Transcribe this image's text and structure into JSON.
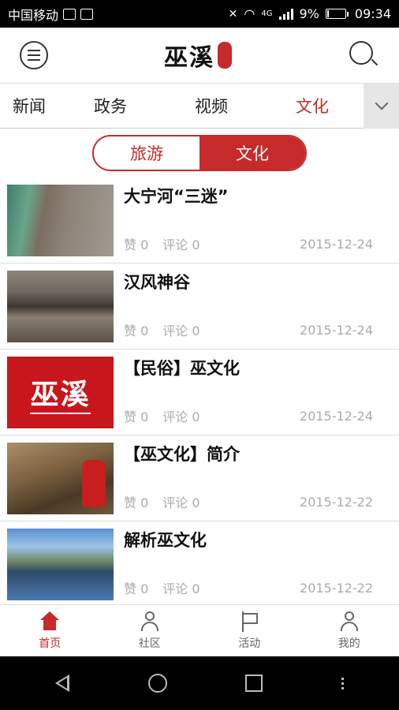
{
  "status_bar": {
    "carrier": "中国移动",
    "network": "4G",
    "battery": "9%",
    "battery_level": 0.09,
    "time": "09:34"
  },
  "header": {
    "logo_text": "巫溪",
    "menu_icon": "menu-icon",
    "search_icon": "search-icon"
  },
  "category_tabs": [
    {
      "label": "新闻",
      "active": false
    },
    {
      "label": "政务",
      "active": false
    },
    {
      "label": "视频",
      "active": false
    },
    {
      "label": "文化",
      "active": true
    }
  ],
  "sub_tabs": [
    {
      "label": "旅游",
      "active": false
    },
    {
      "label": "文化",
      "active": true
    }
  ],
  "articles": [
    {
      "title": "大宁河“三迷”",
      "likes": "赞 0",
      "comments": "评论 0",
      "date": "2015-12-24"
    },
    {
      "title": "汉风神谷",
      "likes": "赞 0",
      "comments": "评论 0",
      "date": "2015-12-24"
    },
    {
      "title": "【民俗】巫文化",
      "likes": "赞 0",
      "comments": "评论 0",
      "date": "2015-12-24",
      "thumb_text": "巫溪"
    },
    {
      "title": "【巫文化】简介",
      "likes": "赞 0",
      "comments": "评论 0",
      "date": "2015-12-22"
    },
    {
      "title": "解析巫文化",
      "likes": "赞 0",
      "comments": "评论 0",
      "date": "2015-12-22"
    }
  ],
  "bottom_nav": [
    {
      "label": "首页",
      "icon": "home-icon",
      "active": true
    },
    {
      "label": "社区",
      "icon": "user-icon",
      "active": false
    },
    {
      "label": "活动",
      "icon": "flag-icon",
      "active": false
    },
    {
      "label": "我的",
      "icon": "user-icon",
      "active": false
    }
  ],
  "colors": {
    "accent": "#c62a2a",
    "text": "#111111",
    "muted": "#aaaaaa"
  }
}
